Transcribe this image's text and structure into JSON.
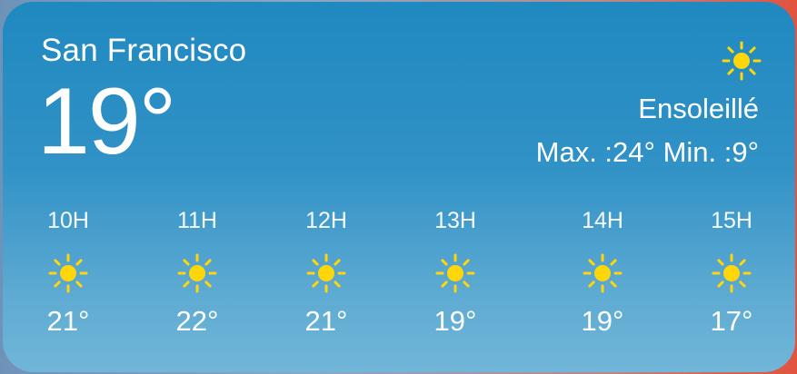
{
  "widget": {
    "city": "San Francisco",
    "current_temp": "19°",
    "condition": "Ensoleillé",
    "condition_icon": "sun-icon",
    "max_label": "Max. :",
    "max_value": "24°",
    "min_label": "Min. :",
    "min_value": "9°"
  },
  "hourly": [
    {
      "hour": "10H",
      "icon": "sun-icon",
      "temp": "21°"
    },
    {
      "hour": "11H",
      "icon": "sun-icon",
      "temp": "22°"
    },
    {
      "hour": "12H",
      "icon": "sun-icon",
      "temp": "21°"
    },
    {
      "hour": "13H",
      "icon": "sun-icon",
      "temp": "19°"
    },
    {
      "hour": "14H",
      "icon": "sun-icon",
      "temp": "19°"
    },
    {
      "hour": "15H",
      "icon": "sun-icon",
      "temp": "17°"
    }
  ],
  "colors": {
    "sun": "#FFD60A",
    "widget_top": "#1f89c0",
    "widget_bottom": "#71b6d9"
  }
}
